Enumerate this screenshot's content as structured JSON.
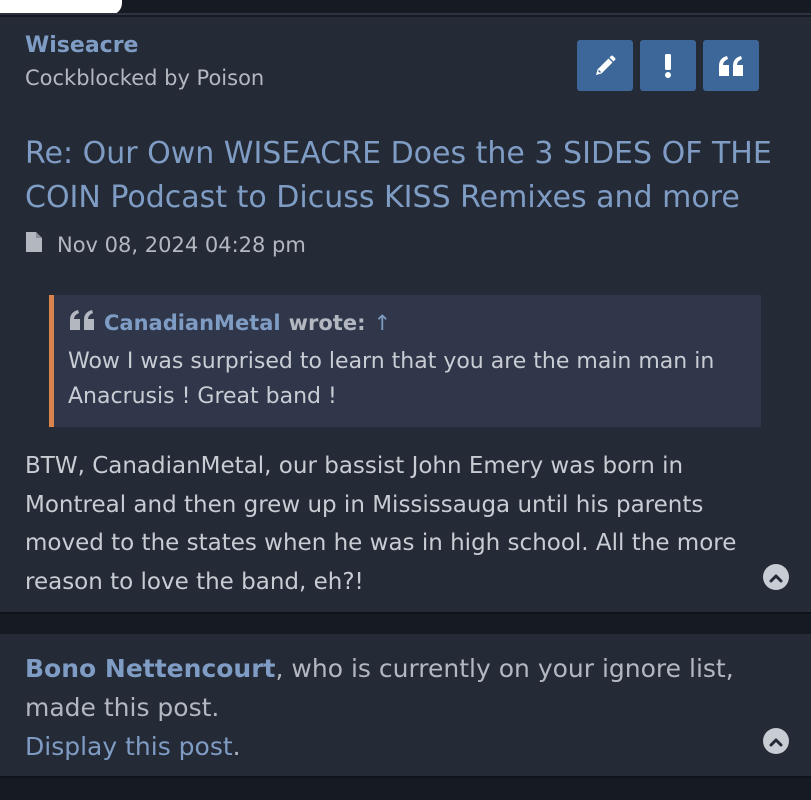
{
  "post": {
    "author": "Wiseacre",
    "rank": "Cockblocked by Poison",
    "buttons": [
      {
        "icon": "pencil-icon",
        "name": "edit-button"
      },
      {
        "icon": "exclamation-icon",
        "name": "report-button"
      },
      {
        "icon": "quote-icon",
        "name": "quote-button"
      }
    ],
    "title": "Re: Our Own WISEACRE Does the 3 SIDES OF THE COIN Podcast to Dicuss KISS Remixes and more",
    "date": "Nov 08, 2024 04:28 pm",
    "quote": {
      "author": "CanadianMetal",
      "wrote": "wrote:",
      "up_arrow": "↑",
      "text": "Wow I was surprised to learn that you are the main man in Anacrusis ! Great band !"
    },
    "body": "BTW, CanadianMetal, our bassist John Emery was born in Montreal and then grew up in Mississauga until his parents moved to the states when he was in high school. All the more reason to love the band, eh?!"
  },
  "ignored": {
    "user": "Bono Nettencourt",
    "message": ", who is currently on your ignore list, made this post.",
    "display_link": "Display this post",
    "period": "."
  },
  "colors": {
    "accent": "#7f9cc4",
    "button": "#3d6799",
    "quote_bar": "#d9844c"
  }
}
